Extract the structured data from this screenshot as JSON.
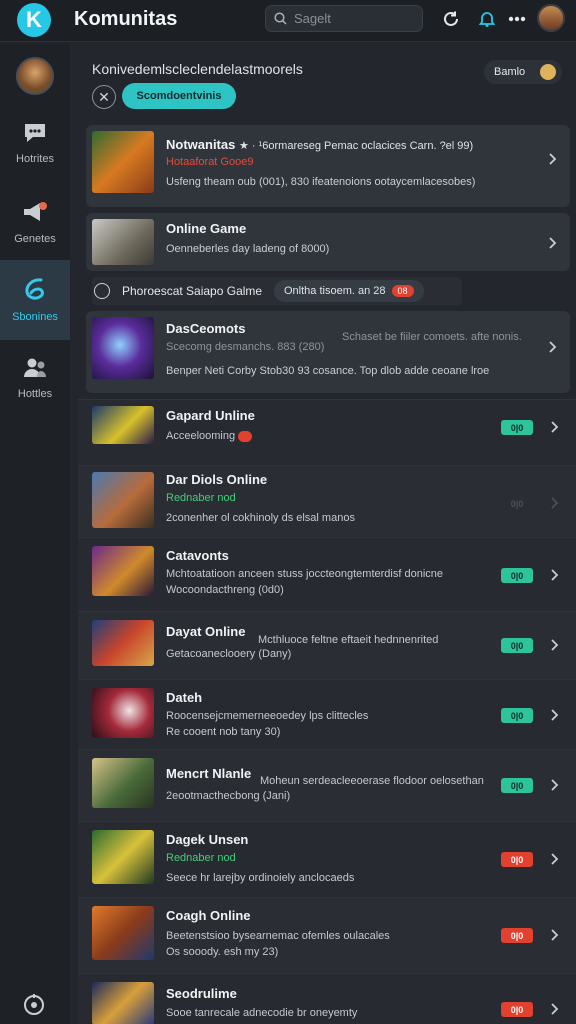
{
  "app": {
    "logo_letter": "K",
    "title": "Komunitas"
  },
  "search": {
    "placeholder": "Sagelt"
  },
  "sidebar": {
    "items": [
      {
        "label": "Hotrites",
        "icon": "chat-bubble-icon"
      },
      {
        "label": "Genetes",
        "icon": "megaphone-icon"
      },
      {
        "label": "Sbonines",
        "icon": "community-logo-icon",
        "active": true
      },
      {
        "label": "Hottles",
        "icon": "people-icon"
      }
    ]
  },
  "main": {
    "header": "Konivedemlscleclendelastmoorels",
    "toggle_label": "Bamlo",
    "pill_label": "Scomdoentvinis",
    "section": {
      "label": "Phoroescat Saiapo Galme",
      "chip": "Onltha tisoem. an 28",
      "chip_count": "08"
    }
  },
  "cards": [
    {
      "title": "Notwanitas",
      "title_suffix": "★ · ¹6ormareseg Pemac oclacices Carn. ?el 99)",
      "sub1": "Hotaaforat Gooe9",
      "sub1_color": "red",
      "sub2": "Usfeng theam oub (001), 830 ifeatenoions ootaycemlacesobes)"
    },
    {
      "title": "Online Game",
      "title_suffix": "",
      "sub1": "Oenneberles day ladeng of 8000)",
      "sub1_color": "",
      "sub2": ""
    },
    {
      "title": "DasCeomots",
      "title_suffix": "",
      "sub1": "Scecomg desmanchs. 883 (280)",
      "sub1_color": "",
      "sub2": "Benper Neti Corby Stob30 93 cosance. Top dlob adde ceoane lroe",
      "extra": "Schaset be fiiler comoets. afte nonis."
    }
  ],
  "rows": [
    {
      "title": "Gapard Unline",
      "sub1": "Acceelooming",
      "sub1_color": "",
      "sub2": "",
      "badge": "0|0",
      "badge_color": "green"
    },
    {
      "title": "Dar Diols Online",
      "sub1": "Rednaber nod",
      "sub1_color": "green",
      "sub2": "2conenher ol cokhinoly ds elsal manos",
      "badge": "0|0",
      "badge_color": "dim"
    },
    {
      "title": "Catavonts",
      "sub1": "Mchtoatatioon anceen stuss joccteongtemterdisf donicne",
      "sub1_color": "",
      "sub2": "Wocoondacthreng (0d0)",
      "badge": "0|0",
      "badge_color": "green"
    },
    {
      "title": "Dayat Online",
      "sub1": "Getacoaneclooery (Dany)",
      "sub1_color": "",
      "sub2": "",
      "extra": "Mcthluoce feltne eftaeit hednnenrited",
      "badge": "0|0",
      "badge_color": "green"
    },
    {
      "title": "Dateh",
      "sub1": "Roocensejcmemerneeoedey lps clittecles",
      "sub1_color": "",
      "sub2": "Re cooent nob tany 30)",
      "badge": "0|0",
      "badge_color": "green"
    },
    {
      "title": "Mencrt Nlanle",
      "sub1": "2eootmacthecbong (Jani)",
      "sub1_color": "",
      "sub2": "",
      "extra": "Moheun serdeacleeoerase flodoor oelosethan",
      "badge": "0|0",
      "badge_color": "green"
    },
    {
      "title": "Dagek Unsen",
      "sub1": "Rednaber nod",
      "sub1_color": "green",
      "sub2": "Seece hr larejby ordinoiely anclocaeds",
      "badge": "0|0",
      "badge_color": "red"
    },
    {
      "title": "Coagh Online",
      "sub1": "Beetenstsioo bysearnemac ofemles oulacales",
      "sub1_color": "",
      "sub2": "Os sooody. esh my 23)",
      "badge": "0|0",
      "badge_color": "red"
    },
    {
      "title": "Seodrulime",
      "sub1": "Sooe tanrecale adnecodie br oneyemty",
      "sub1_color": "",
      "sub2": "",
      "badge": "0|0",
      "badge_color": "red"
    }
  ],
  "colors": {
    "accent": "#27c7e6",
    "badge_green": "#2ec49b",
    "badge_red": "#e2412f",
    "sub_red": "#e24c3d",
    "sub_green": "#3fcf77"
  }
}
